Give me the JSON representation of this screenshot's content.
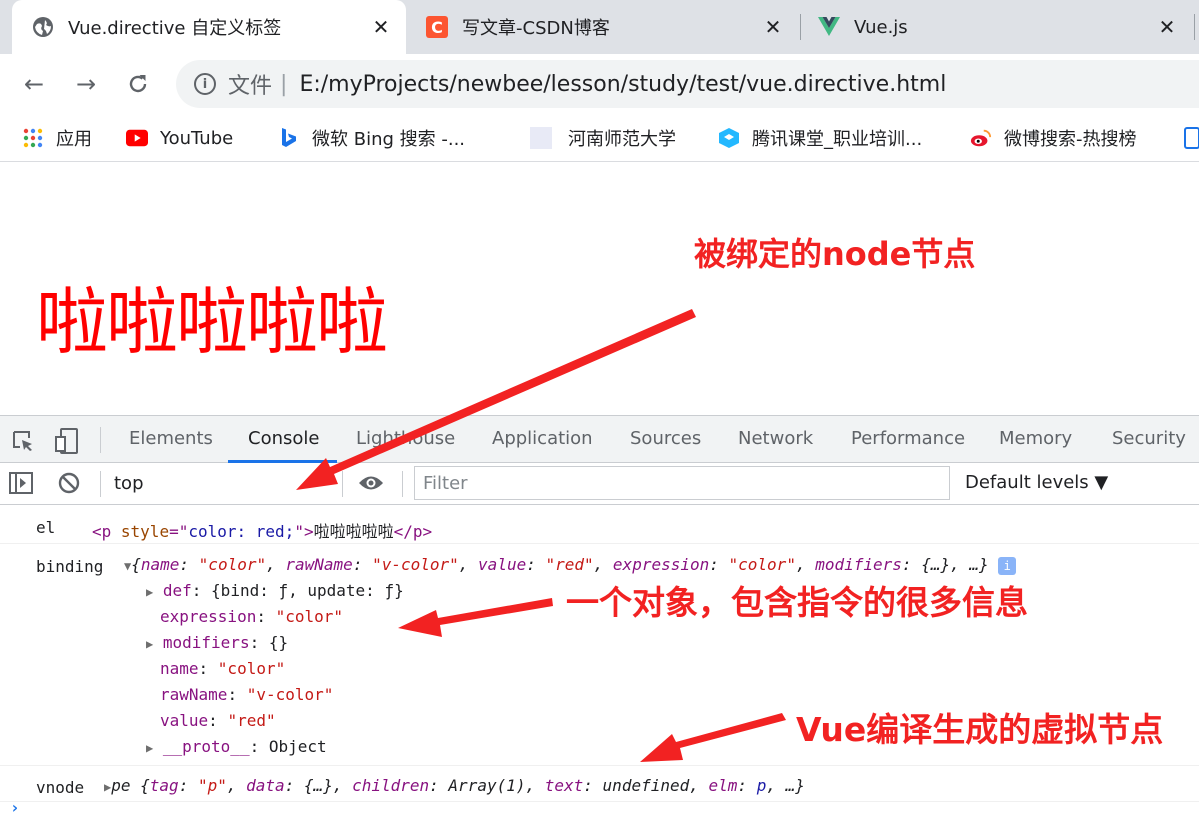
{
  "browser": {
    "tabs": [
      {
        "title": "Vue.directive 自定义标签",
        "active": true,
        "favicon": "globe-icon"
      },
      {
        "title": "写文章-CSDN博客",
        "active": false,
        "favicon": "csdn-icon",
        "favicon_letter": "C"
      },
      {
        "title": "Vue.js",
        "active": false,
        "favicon": "vue-icon"
      }
    ],
    "close_glyph": "✕",
    "address": {
      "protocol_label": "文件",
      "separator": "|",
      "url": "E:/myProjects/newbee/lesson/study/test/vue.directive.html",
      "info_glyph": "i"
    },
    "nav": {
      "back": "←",
      "forward": "→",
      "reload": "C"
    },
    "bookmarks": [
      {
        "label": "应用",
        "icon": "apps-grid-icon"
      },
      {
        "label": "YouTube",
        "icon": "youtube-icon"
      },
      {
        "label": "微软 Bing 搜索 -...",
        "icon": "bing-icon"
      },
      {
        "label": "河南师范大学",
        "icon": "blank-page-icon"
      },
      {
        "label": "腾讯课堂_职业培训...",
        "icon": "tencent-classroom-icon"
      },
      {
        "label": "微博搜索-热搜榜",
        "icon": "weibo-icon"
      }
    ]
  },
  "page": {
    "big_text": "啦啦啦啦啦",
    "text_color": "#ff0000"
  },
  "annotations": {
    "node": "被绑定的node节点",
    "binding": "一个对象，包含指令的很多信息",
    "vnode": "Vue编译生成的虚拟节点",
    "color": "#f22222"
  },
  "devtools": {
    "tabs": [
      "Elements",
      "Console",
      "Lighthouse",
      "Application",
      "Sources",
      "Network",
      "Performance",
      "Memory",
      "Security"
    ],
    "active_tab": "Console",
    "context": "top",
    "filter_placeholder": "Filter",
    "levels": "Default levels ▼"
  },
  "console": {
    "el": {
      "label": "el",
      "open": "<p",
      "attr": "style",
      "eq": "=\"",
      "value": "color: red;",
      "close_q": "\">",
      "text": "啦啦啦啦啦",
      "end": "</p>"
    },
    "binding": {
      "label": "binding",
      "summary_open": "{",
      "s_name_k": "name",
      "s_name_v": "\"color\"",
      "s_raw_k": "rawName",
      "s_raw_v": "\"v-color\"",
      "s_val_k": "value",
      "s_val_v": "\"red\"",
      "s_exp_k": "expression",
      "s_exp_v": "\"color\"",
      "s_mod_k": "modifiers",
      "s_mod_v": "{…}, …}",
      "info": "i",
      "def_k": "def",
      "def_v": "{bind: ƒ, update: ƒ}",
      "expression_k": "expression",
      "expression_v": "\"color\"",
      "modifiers_k": "modifiers",
      "modifiers_v": "{}",
      "name_k": "name",
      "name_v": "\"color\"",
      "rawName_k": "rawName",
      "rawName_v": "\"v-color\"",
      "value_k": "value",
      "value_v": "\"red\"",
      "proto_k": "__proto__",
      "proto_v": "Object"
    },
    "vnode": {
      "label": "vnode",
      "ctor": "pe",
      "open": "{",
      "tag_k": "tag",
      "tag_v": "\"p\"",
      "data_k": "data",
      "data_v": "{…}",
      "children_k": "children",
      "children_v": "Array(1)",
      "text_k": "text",
      "text_v": "undefined",
      "elm_k": "elm",
      "elm_v": "p",
      "tail": "…}"
    },
    "prompt": "›"
  },
  "colors": {
    "accent": "#1a73e8",
    "annotation": "#f22222",
    "page_text": "#ff0000"
  }
}
